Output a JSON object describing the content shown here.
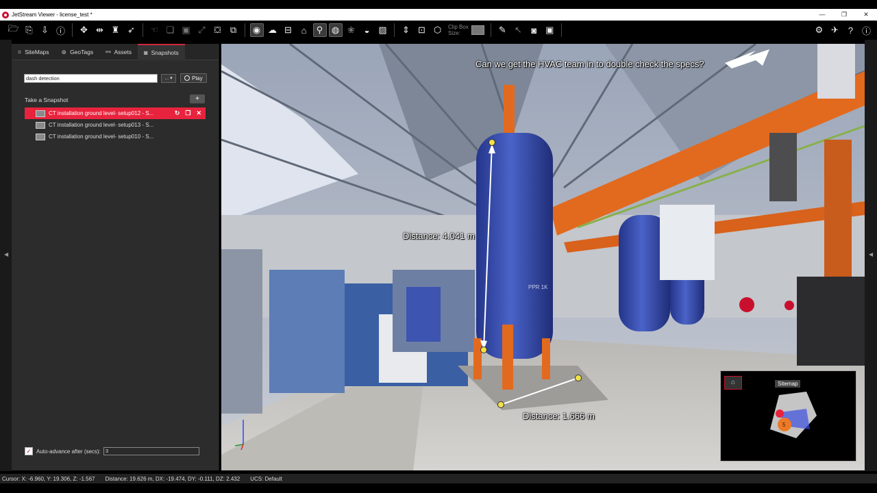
{
  "window": {
    "title": "JetStream Viewer - license_test *",
    "controls": [
      "—",
      "❐",
      "✕"
    ]
  },
  "toolbar": {
    "clip_box_label": "Clip Box",
    "size_label": "Size:",
    "groups": [
      [
        "folder-open-icon",
        "file-icon",
        "export-icon",
        "info-icon"
      ],
      [
        "move-icon",
        "measure-icon",
        "person-walk-icon",
        "fly-icon"
      ],
      [
        "select-icon",
        "layers-icon",
        "box-icon",
        "zoom-extents-icon",
        "cube-icon",
        "view-cube-icon"
      ],
      [
        "view-mode-icon",
        "cloud-icon",
        "slice-icon",
        "sitemap-icon",
        "geotag-icon",
        "snapshot-view-icon",
        "color-icon",
        "half-circle-icon",
        "image-icon"
      ],
      [
        "height-icon",
        "clip-icon",
        "clip-box-icon"
      ],
      [
        "ruler-icon",
        "pointer-icon",
        "camera-icon",
        "video-icon"
      ]
    ],
    "right": [
      "gear-icon",
      "plugin-icon",
      "help-icon",
      "about-icon"
    ]
  },
  "sidebar": {
    "tabs": [
      {
        "label": "SiteMaps",
        "icon": "sitemap-icon"
      },
      {
        "label": "GeoTags",
        "icon": "globe-icon"
      },
      {
        "label": "Assets",
        "icon": "paperclip-icon"
      },
      {
        "label": "Snapshots",
        "icon": "camera-icon"
      }
    ],
    "active_tab": "Snapshots",
    "search_value": "dash detection",
    "dropdown_label": "...",
    "play_label": "Play",
    "snapshot_header": "Take a Snapshot",
    "add_label": "+",
    "snapshots": [
      {
        "label": "CT installation ground level- setup012 - S..."
      },
      {
        "label": "CT installation ground level- setup013 - S..."
      },
      {
        "label": "CT installation ground level- setup010 - S..."
      }
    ],
    "selected_index": 0,
    "auto_advance_label": "Auto-advance after (secs):",
    "auto_advance_value": "3",
    "auto_advance_checked": true
  },
  "viewport": {
    "annotation_note": "Can we get the HVAC team in to double check the  specs?",
    "measure_vertical": "Distance: 4.041 m",
    "measure_horizontal": "Distance: 1.666 m",
    "vessel_label": "PPR 1K",
    "minimap_title": "Sitemap",
    "minimap_marker": "5"
  },
  "status": {
    "cursor": "Cursor: X: -6.960, Y: 19.306, Z: -1.567",
    "distance": "Distance: 19.626 m, DX: -19.474, DY: -0.111, DZ: 2.432",
    "ucs": "UCS: Default"
  },
  "colors": {
    "accent": "#e8233d",
    "steel": "#e26a1f",
    "vessel": "#3a4fb0",
    "floor": "#c8c6c2"
  }
}
